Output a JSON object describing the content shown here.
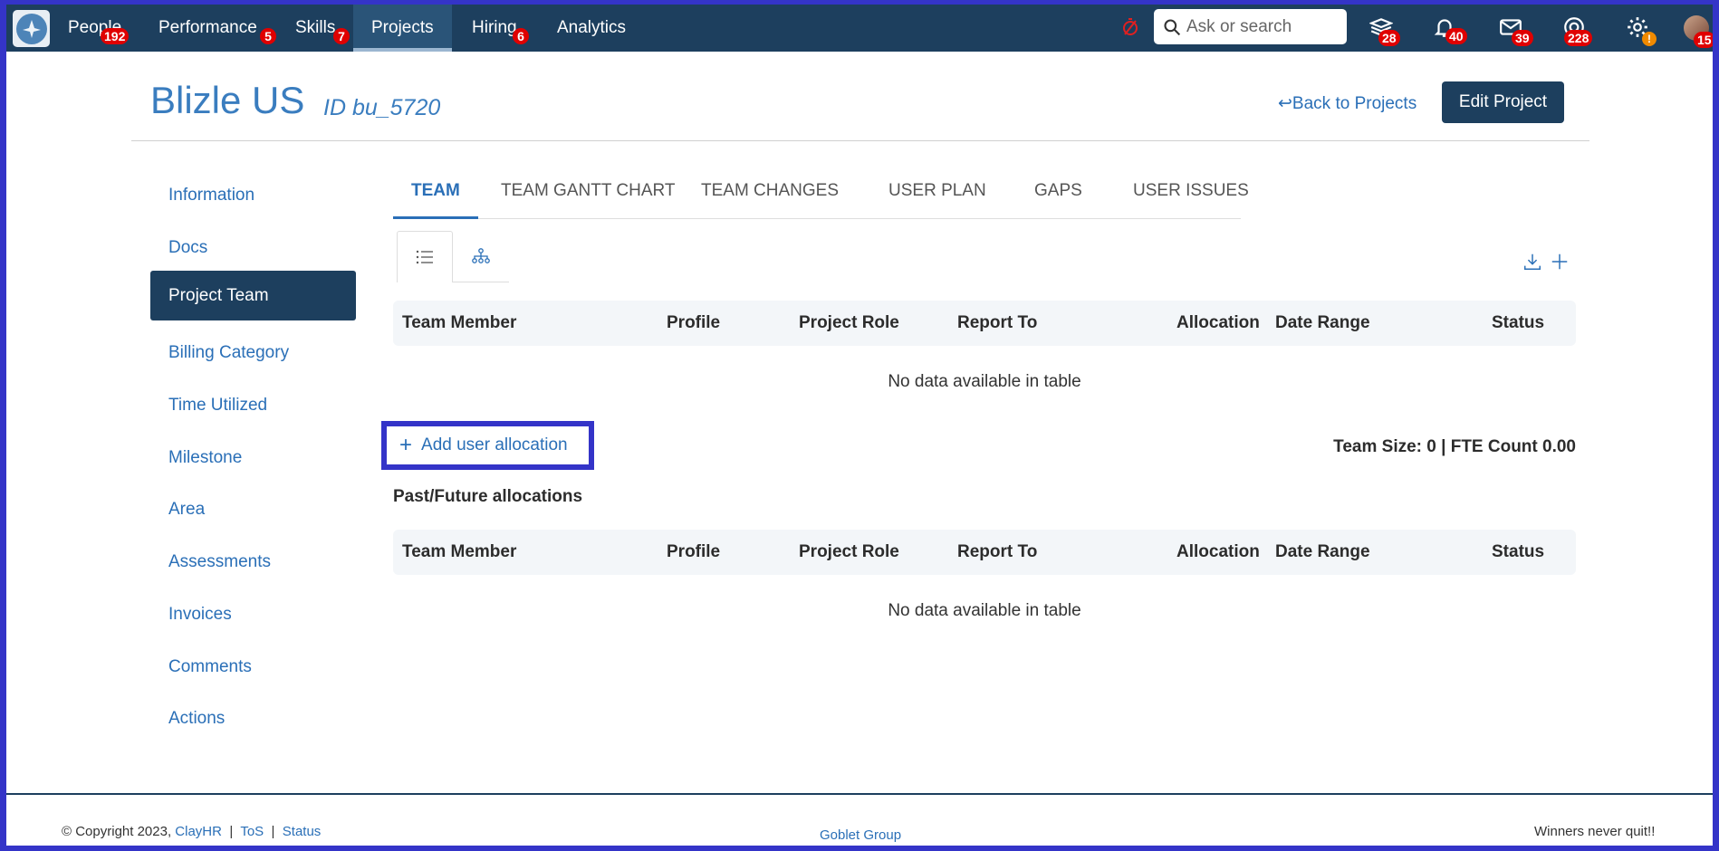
{
  "nav": {
    "items": [
      {
        "label": "People",
        "badge": "192"
      },
      {
        "label": "Performance",
        "badge": "5"
      },
      {
        "label": "Skills",
        "badge": "7"
      },
      {
        "label": "Projects",
        "badge": ""
      },
      {
        "label": "Hiring",
        "badge": "6"
      },
      {
        "label": "Analytics",
        "badge": ""
      }
    ],
    "active": "Projects",
    "search_placeholder": "Ask or search",
    "icon_badges": {
      "courses": "28",
      "notifications": "40",
      "messages": "39",
      "support": "228",
      "settings": "!",
      "profile": "15"
    },
    "colors": {
      "bar": "#1d3f5e",
      "badge": "#e00000",
      "settings_badge": "#f08a00"
    }
  },
  "header": {
    "title": "Blizle US",
    "id_text": "ID bu_5720",
    "back_label": "Back to Projects",
    "edit_label": "Edit Project"
  },
  "sidebar": {
    "items": [
      {
        "label": "Information"
      },
      {
        "label": "Docs"
      },
      {
        "label": "Project Team"
      },
      {
        "label": "Billing Category"
      },
      {
        "label": "Time Utilized"
      },
      {
        "label": "Milestone"
      },
      {
        "label": "Area"
      },
      {
        "label": "Assessments"
      },
      {
        "label": "Invoices"
      },
      {
        "label": "Comments"
      },
      {
        "label": "Actions"
      }
    ],
    "active": "Project Team"
  },
  "tabs": {
    "items": [
      "TEAM",
      "TEAM GANTT CHART",
      "TEAM CHANGES",
      "USER PLAN",
      "GAPS",
      "USER ISSUES"
    ],
    "active": "TEAM"
  },
  "table": {
    "columns": [
      "Team Member",
      "Profile",
      "Project Role",
      "Report To",
      "Allocation",
      "Date Range",
      "Status"
    ],
    "empty_message": "No data available in table"
  },
  "add_allocation_label": "Add user allocation",
  "team_size_text": "Team Size: 0 | FTE Count 0.00",
  "past_future": {
    "title": "Past/Future allocations",
    "columns": [
      "Team Member",
      "Profile",
      "Project Role",
      "Report To",
      "Allocation",
      "Date Range",
      "Status"
    ],
    "empty_message": "No data available in table"
  },
  "footer": {
    "copyright": "© Copyright 2023,",
    "company": "ClayHR",
    "sep": "|",
    "tos": "ToS",
    "status": "Status",
    "center": "Goblet Group",
    "right": "Winners never quit!!"
  },
  "accent_color": "#2a6fb7"
}
